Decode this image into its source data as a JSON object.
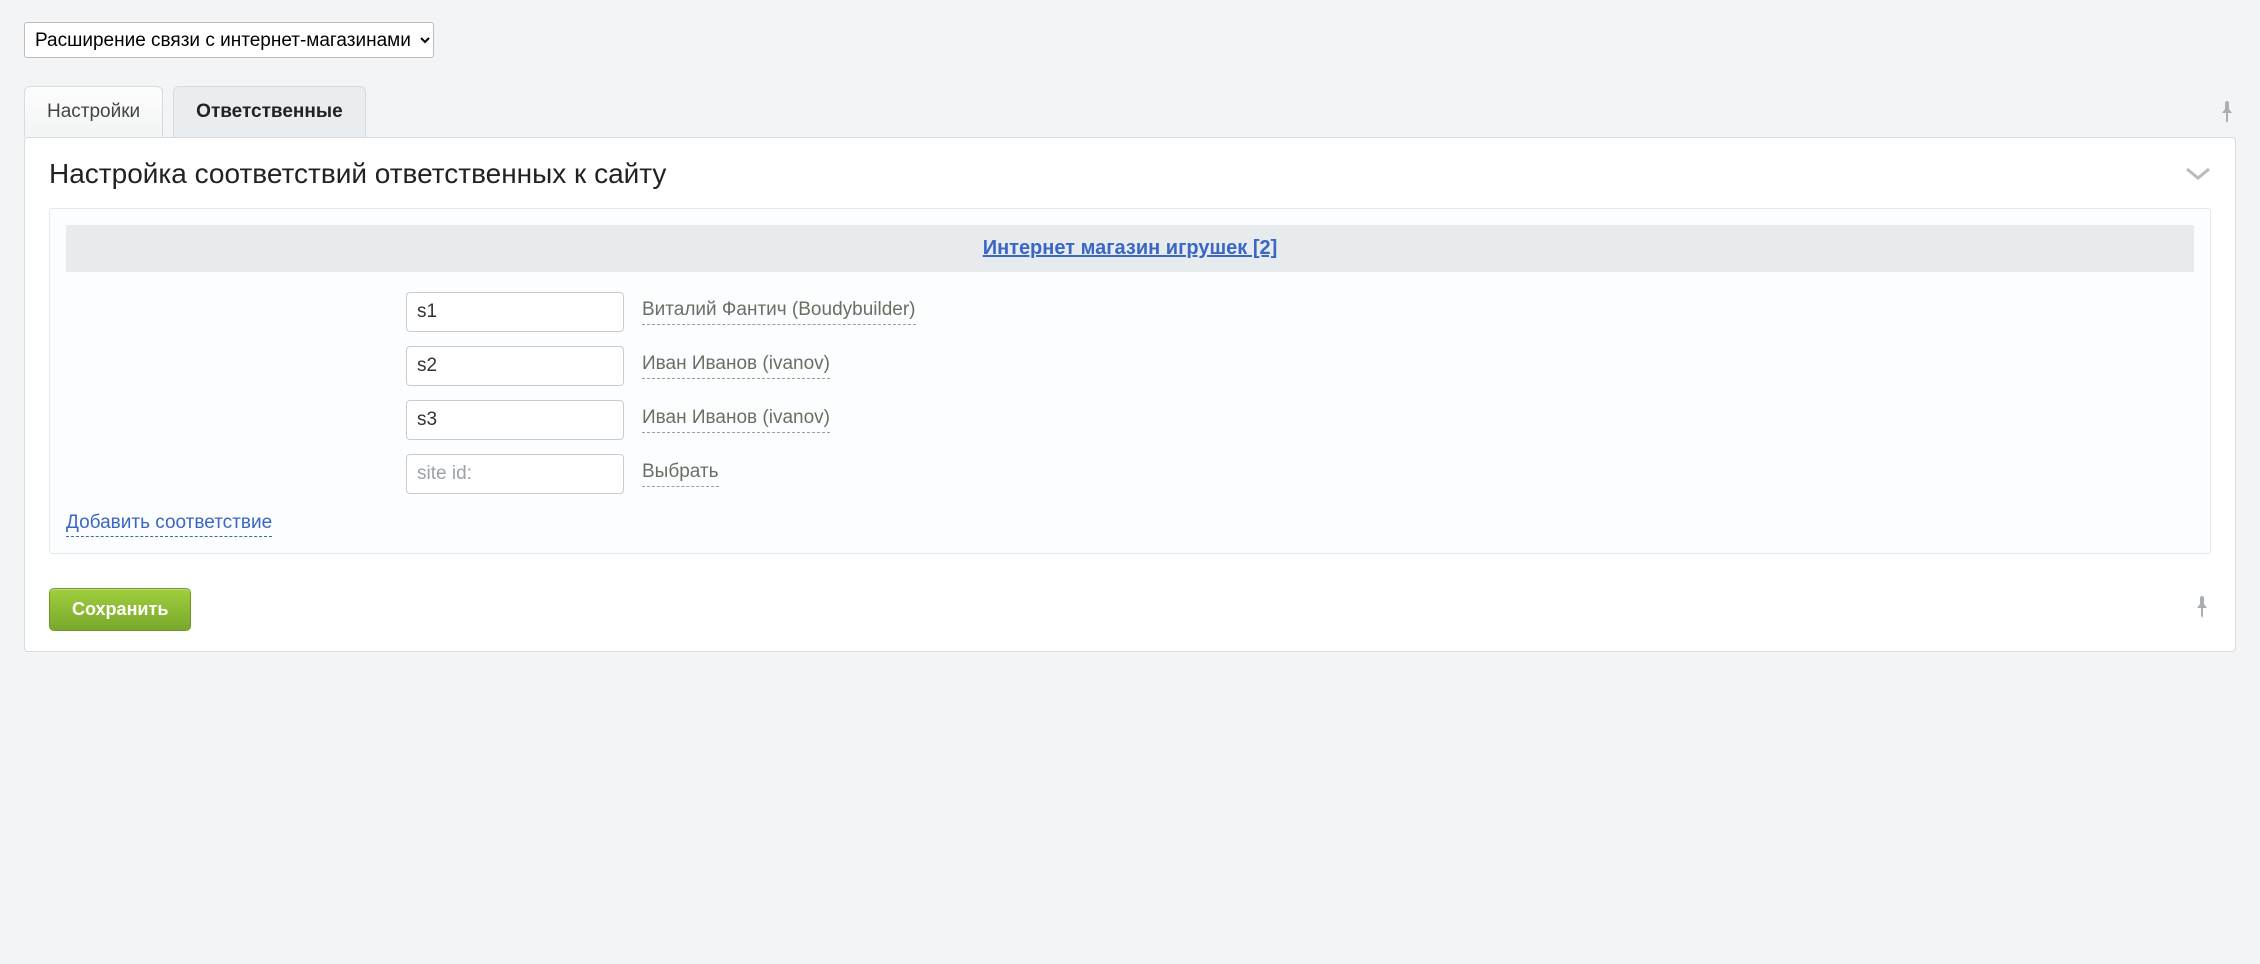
{
  "top_select": {
    "selected": "Расширение связи с интернет-магазинами"
  },
  "tabs": [
    {
      "label": "Настройки",
      "active": false
    },
    {
      "label": "Ответственные",
      "active": true
    }
  ],
  "panel": {
    "title": "Настройка соответствий ответственных к сайту"
  },
  "shop": {
    "link_text": "Интернет магазин игрушек [2]"
  },
  "rows": [
    {
      "value": "s1",
      "user": "Виталий Фантич (Boudybuilder)"
    },
    {
      "value": "s2",
      "user": "Иван Иванов (ivanov)"
    },
    {
      "value": "s3",
      "user": "Иван Иванов (ivanov)"
    }
  ],
  "new_row": {
    "placeholder": "site id:",
    "select_text": "Выбрать"
  },
  "links": {
    "add": "Добавить соответствие"
  },
  "buttons": {
    "save": "Сохранить"
  }
}
